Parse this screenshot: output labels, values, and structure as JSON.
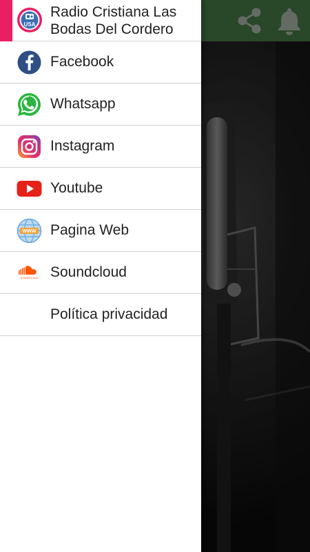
{
  "drawer": {
    "header_title": "Radio Cristiana Las Bodas Del Cordero",
    "logo_text": "USA",
    "items": [
      {
        "label": "Facebook",
        "icon": "facebook-icon"
      },
      {
        "label": "Whatsapp",
        "icon": "whatsapp-icon"
      },
      {
        "label": "Instagram",
        "icon": "instagram-icon"
      },
      {
        "label": "Youtube",
        "icon": "youtube-icon"
      },
      {
        "label": "Pagina Web",
        "icon": "globe-www-icon"
      },
      {
        "label": "Soundcloud",
        "icon": "soundcloud-icon"
      },
      {
        "label": "Política privacidad",
        "icon": ""
      }
    ]
  },
  "toolbar": {
    "color": "#3e6f3f",
    "icons": [
      "share-icon",
      "bell-icon"
    ]
  },
  "colors": {
    "accent": "#e91e63",
    "facebook": "#3b5998",
    "whatsapp": "#25d366",
    "youtube": "#e62117",
    "soundcloud": "#ff5500"
  }
}
